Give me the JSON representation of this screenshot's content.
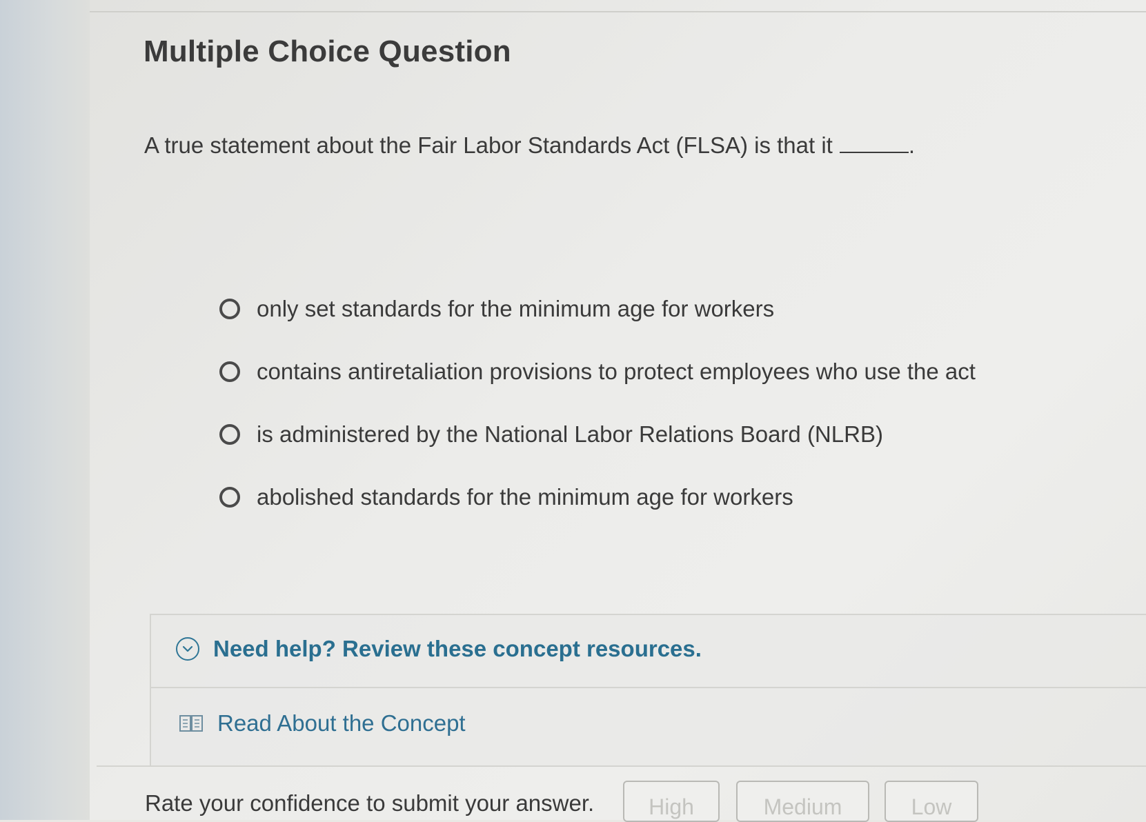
{
  "question": {
    "type_heading": "Multiple Choice Question",
    "prompt": "A true statement about the Fair Labor Standards Act (FLSA) is that it",
    "prompt_end": ".",
    "options": [
      {
        "label": "only set standards for the minimum age for workers"
      },
      {
        "label": "contains antiretaliation provisions to protect employees who use the act"
      },
      {
        "label": "is administered by the National Labor Relations Board (NLRB)"
      },
      {
        "label": "abolished standards for the minimum age for workers"
      }
    ]
  },
  "help": {
    "toggle_label": "Need help? Review these concept resources.",
    "toggle_icon": "chevron-down-icon",
    "resources": [
      {
        "label": "Read About the Concept",
        "icon": "book-icon"
      }
    ]
  },
  "confidence": {
    "label": "Rate your confidence to submit your answer.",
    "buttons": [
      "High",
      "Medium",
      "Low"
    ]
  },
  "colors": {
    "link": "#2a6f90",
    "text": "#3a3a3a",
    "disabled": "#c4c4c0"
  }
}
